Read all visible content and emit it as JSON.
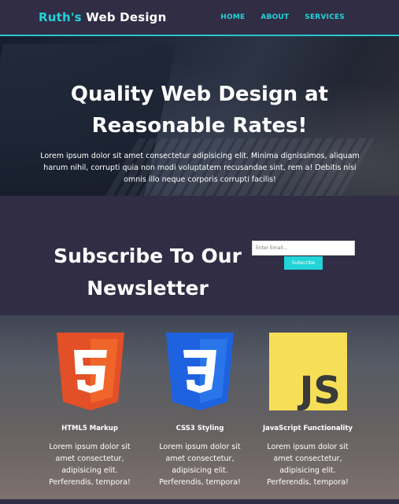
{
  "header": {
    "logo_accent": "Ruth's",
    "logo_rest": " Web Design",
    "nav": [
      "HOME",
      "ABOUT",
      "SERVICES"
    ]
  },
  "hero": {
    "title_line1": "Quality Web Design at",
    "title_line2": "Reasonable Rates!",
    "text": "Lorem ipsum dolor sit amet consectetur adipisicing elit. Minima dignissimos, aliquam harum nihil, corrupti quia non modi voluptatem recusandae sint, rem a! Debitis nisi omnis illo neque corporis corrupti facilis!"
  },
  "newsletter": {
    "title_line1": "Subscribe To Our",
    "title_line2": "Newsletter",
    "email_placeholder": "Enter Email...",
    "subscribe_label": "Subscribe"
  },
  "features": [
    {
      "icon": "html5-icon",
      "icon_text": "5",
      "title": "HTML5 Markup",
      "desc_lines": [
        "Lorem ipsum dolor sit",
        "amet consectetur,",
        "adipisicing elit.",
        "Perferendis, tempora!"
      ]
    },
    {
      "icon": "css3-icon",
      "icon_text": "3",
      "title": "CSS3 Styling",
      "desc_lines": [
        "Lorem ipsum dolor sit",
        "amet consectetur,",
        "adipisicing elit.",
        "Perferendis, tempora!"
      ]
    },
    {
      "icon": "js-icon",
      "icon_text": "JS",
      "title": "JavaScript Functionality",
      "desc_lines": [
        "Lorem ipsum dolor sit",
        "amet consectetur,",
        "adipisicing elit.",
        "Perferendis, tempora!"
      ]
    }
  ],
  "colors": {
    "accent": "#22d3d8",
    "dark": "#302d45",
    "html5": "#e34f26",
    "css3": "#1f62e0",
    "js": "#f6df57"
  }
}
